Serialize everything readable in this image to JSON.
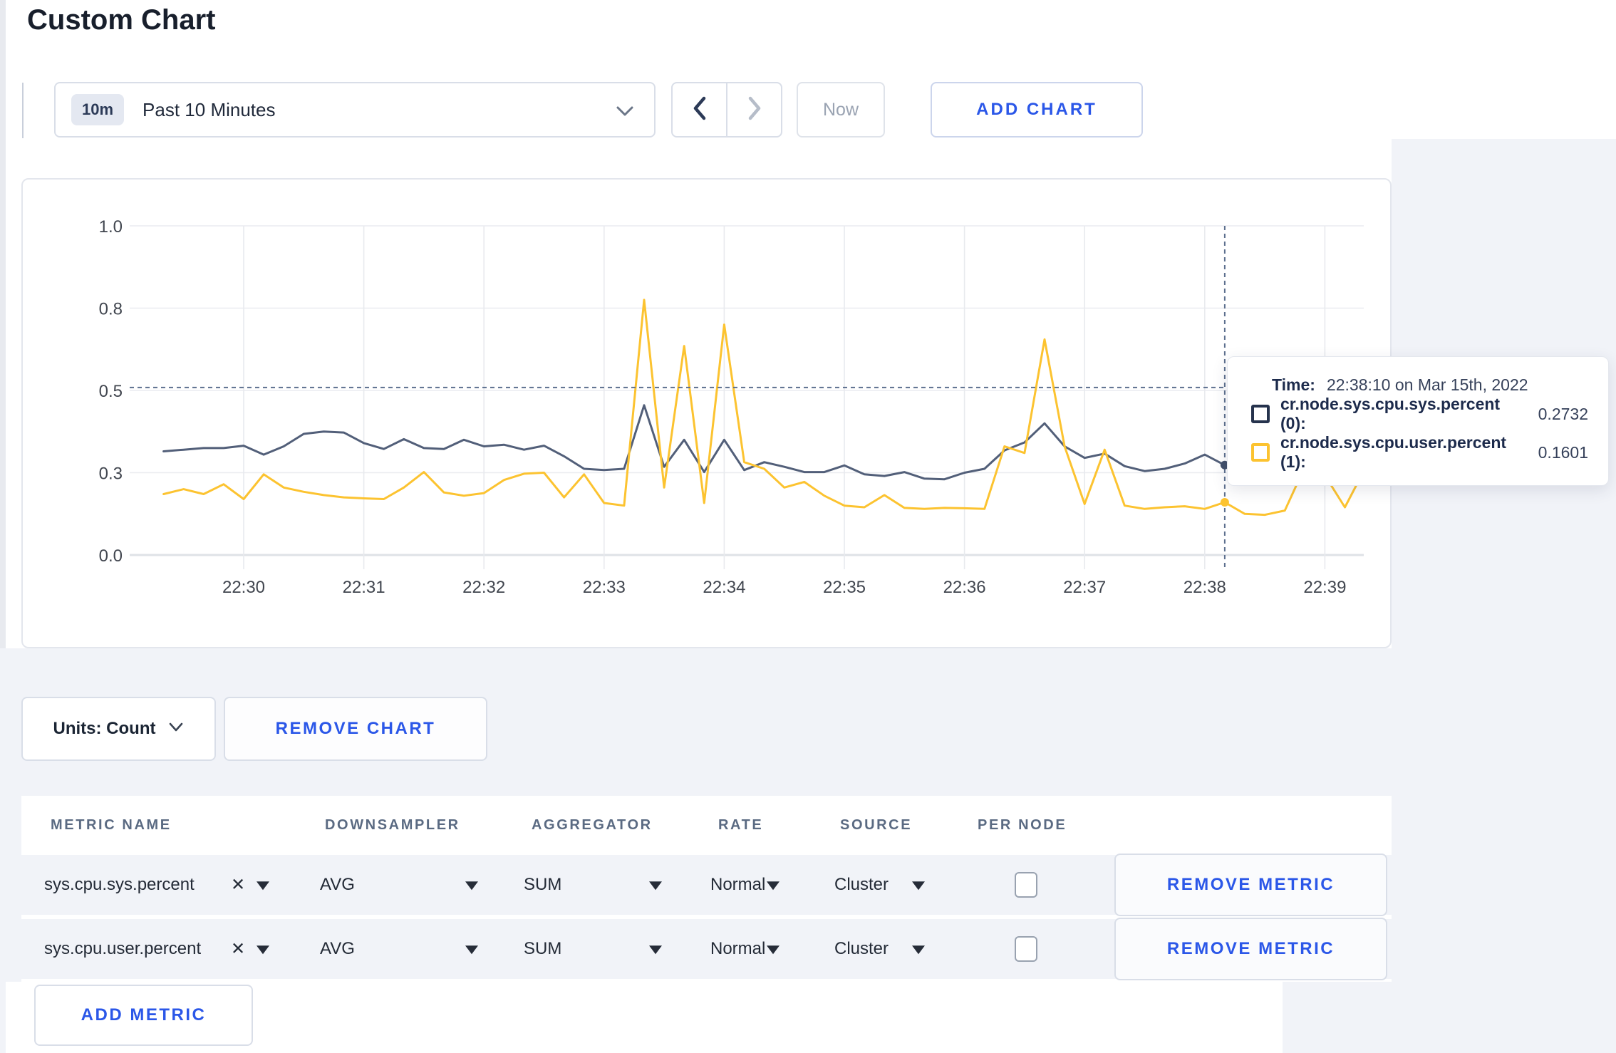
{
  "page": {
    "title": "Custom Chart"
  },
  "toolbar": {
    "time_badge": "10m",
    "time_label": "Past 10 Minutes",
    "now_label": "Now",
    "add_chart_label": "ADD CHART"
  },
  "chart_data": {
    "type": "line",
    "title": "",
    "xlabel": "",
    "ylabel": "",
    "x_tick_labels": [
      "22:30",
      "22:31",
      "22:32",
      "22:33",
      "22:34",
      "22:35",
      "22:36",
      "22:37",
      "22:38",
      "22:39"
    ],
    "y_axis": {
      "range": [
        0,
        1
      ],
      "tick_values": [
        0,
        0.25,
        0.5,
        0.75,
        1
      ],
      "tick_labels": [
        "0.0",
        "0.3",
        "0.5",
        "0.8",
        "1.0"
      ]
    },
    "grid": true,
    "start_time": "22:29:20",
    "interval_seconds": 10,
    "series": [
      {
        "name": "cr.node.sys.cpu.sys.percent (0)",
        "color": "#525f79",
        "values": [
          0.315,
          0.32,
          0.325,
          0.325,
          0.332,
          0.305,
          0.33,
          0.368,
          0.375,
          0.372,
          0.34,
          0.322,
          0.352,
          0.325,
          0.322,
          0.35,
          0.33,
          0.335,
          0.32,
          0.332,
          0.3,
          0.262,
          0.258,
          0.262,
          0.455,
          0.268,
          0.35,
          0.252,
          0.35,
          0.258,
          0.282,
          0.268,
          0.252,
          0.252,
          0.272,
          0.245,
          0.24,
          0.252,
          0.232,
          0.23,
          0.25,
          0.262,
          0.318,
          0.342,
          0.4,
          0.33,
          0.295,
          0.308,
          0.27,
          0.255,
          0.262,
          0.278,
          0.305,
          0.2732,
          0.268,
          0.272,
          0.268,
          0.272,
          0.295,
          0.288,
          0.298
        ]
      },
      {
        "name": "cr.node.sys.cpu.user.percent (1)",
        "color": "#fcc330",
        "values": [
          0.185,
          0.2,
          0.185,
          0.215,
          0.17,
          0.245,
          0.205,
          0.192,
          0.182,
          0.175,
          0.172,
          0.17,
          0.205,
          0.252,
          0.19,
          0.18,
          0.188,
          0.228,
          0.247,
          0.25,
          0.175,
          0.245,
          0.158,
          0.15,
          0.775,
          0.205,
          0.635,
          0.158,
          0.7,
          0.282,
          0.262,
          0.205,
          0.222,
          0.18,
          0.15,
          0.145,
          0.182,
          0.143,
          0.14,
          0.143,
          0.142,
          0.14,
          0.33,
          0.31,
          0.655,
          0.33,
          0.155,
          0.32,
          0.15,
          0.14,
          0.145,
          0.148,
          0.14,
          0.1601,
          0.125,
          0.122,
          0.135,
          0.268,
          0.242,
          0.145,
          0.262
        ]
      }
    ],
    "crosshair": {
      "time": "22:38:10",
      "index": 53,
      "mouse_value": 0.509
    },
    "legend_position": "tooltip"
  },
  "tooltip": {
    "time_label": "Time:",
    "time_value": "22:38:10 on Mar 15th, 2022",
    "series": [
      {
        "label": "cr.node.sys.cpu.sys.percent (0):",
        "value": "0.2732",
        "color": "#26334d"
      },
      {
        "label": "cr.node.sys.cpu.user.percent (1):",
        "value": "0.1601",
        "color": "#fcc330"
      }
    ]
  },
  "chart_footer": {
    "units_label": "Units: Count",
    "remove_chart_label": "REMOVE CHART"
  },
  "metrics_table": {
    "columns": [
      "METRIC NAME",
      "DOWNSAMPLER",
      "AGGREGATOR",
      "RATE",
      "SOURCE",
      "PER NODE"
    ],
    "rows": [
      {
        "metric_name": "sys.cpu.sys.percent",
        "downsampler": "AVG",
        "aggregator": "SUM",
        "rate": "Normal",
        "source": "Cluster",
        "per_node_checked": false,
        "remove_label": "REMOVE METRIC"
      },
      {
        "metric_name": "sys.cpu.user.percent",
        "downsampler": "AVG",
        "aggregator": "SUM",
        "rate": "Normal",
        "source": "Cluster",
        "per_node_checked": false,
        "remove_label": "REMOVE METRIC"
      }
    ],
    "add_metric_label": "ADD METRIC"
  }
}
